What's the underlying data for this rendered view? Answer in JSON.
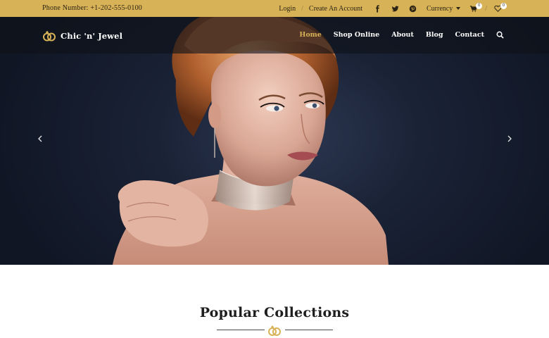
{
  "topbar": {
    "phone": "Phone Number: +1-202-555-0100",
    "login": "Login",
    "separator": "/",
    "create_account": "Create An Account",
    "currency": "Currency",
    "cart_count": "0",
    "wishlist_count": "0"
  },
  "brand": {
    "name": "Chic 'n' Jewel",
    "accent_color": "#d8b257"
  },
  "nav": {
    "items": [
      "Home",
      "Shop Online",
      "About",
      "Blog",
      "Contact"
    ],
    "active": "Home"
  },
  "hero": {
    "prev_icon": "chevron-left-icon",
    "next_icon": "chevron-right-icon"
  },
  "section": {
    "title": "Popular Collections"
  }
}
